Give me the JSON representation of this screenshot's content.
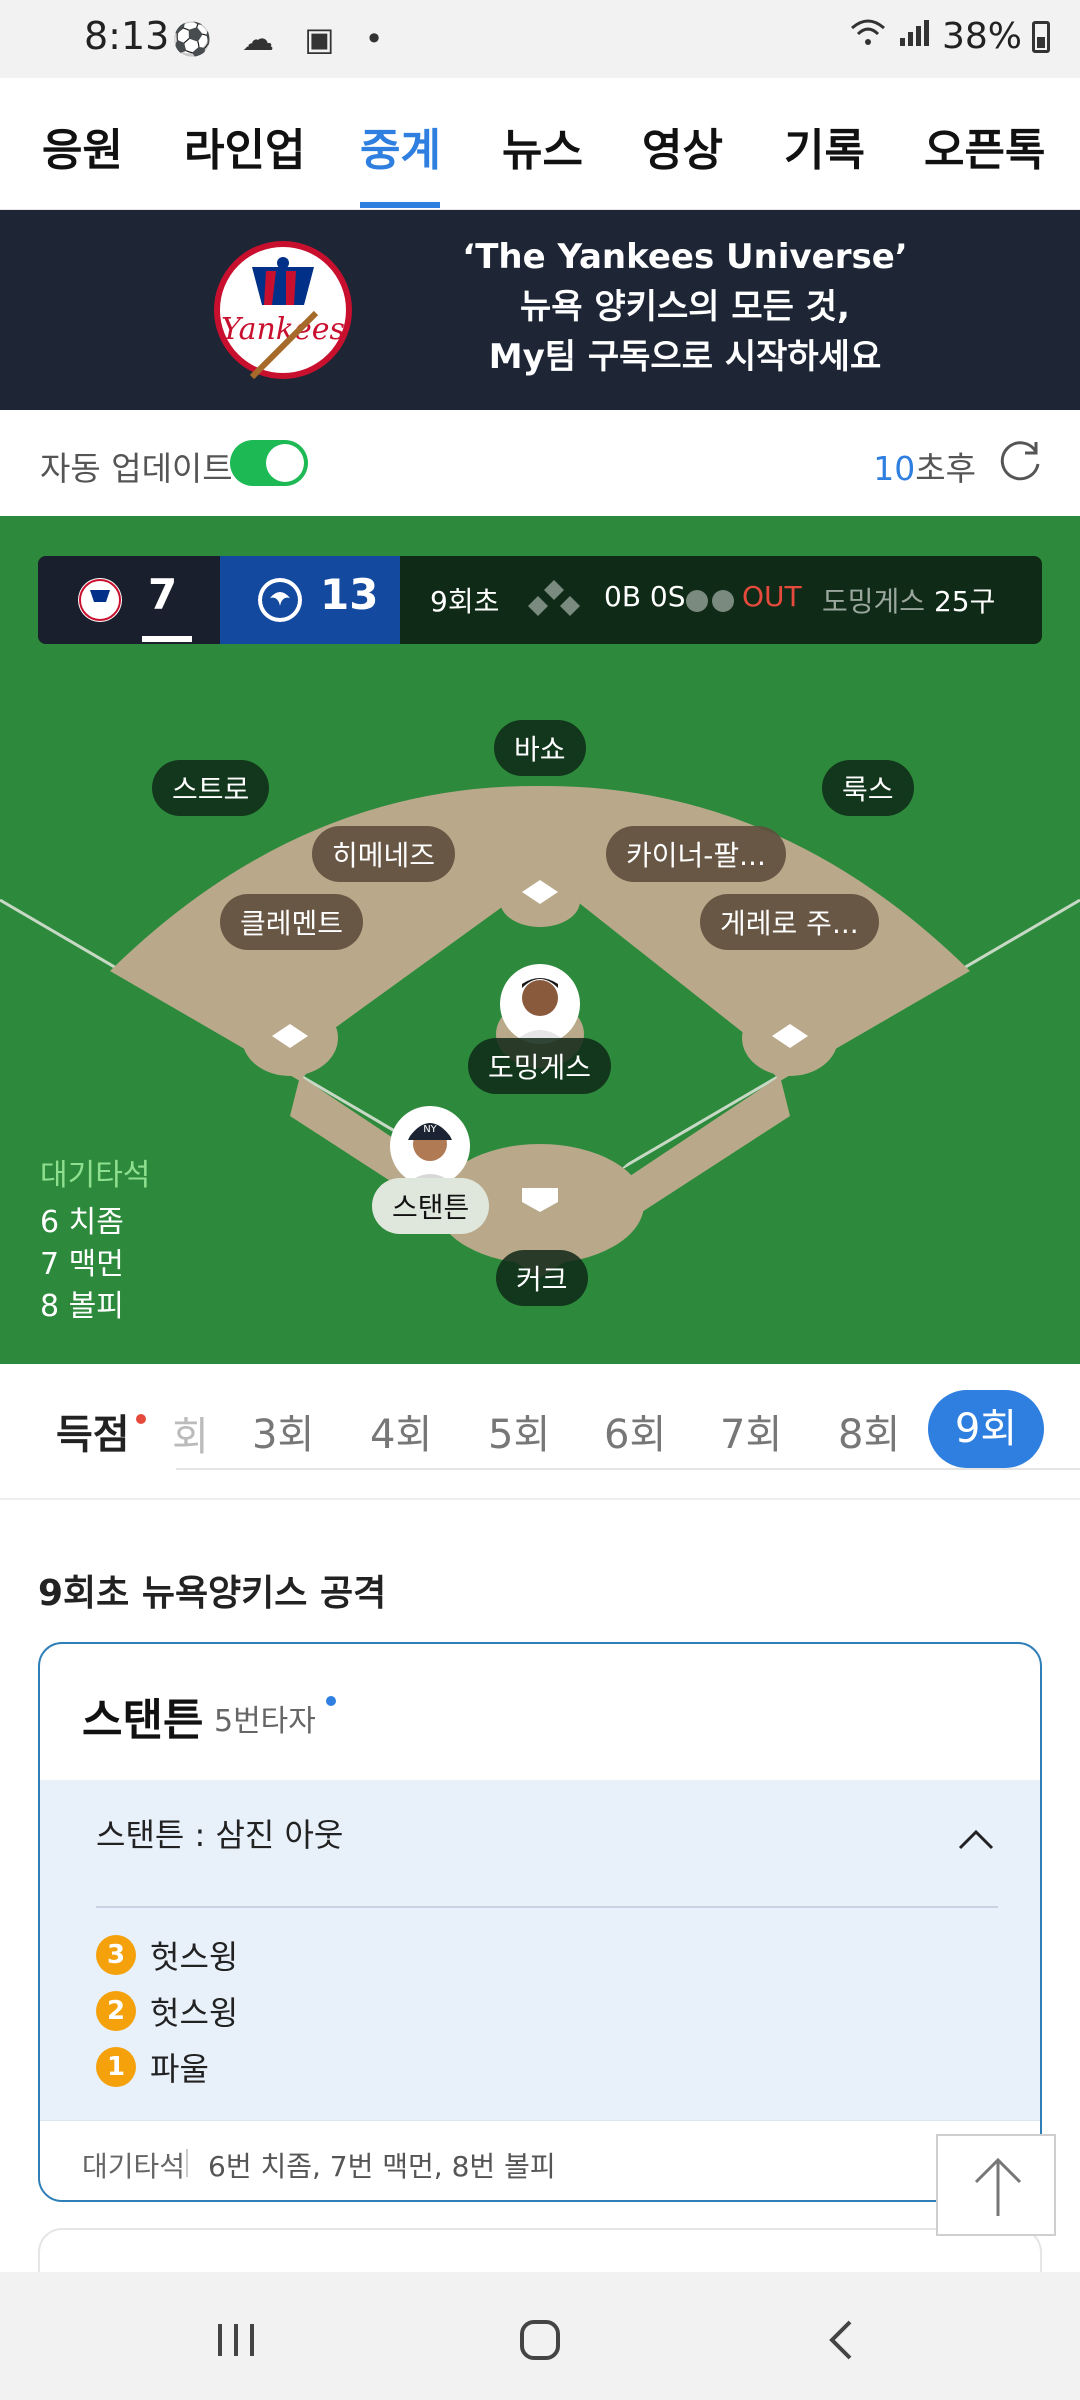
{
  "status_bar": {
    "time": "8:13",
    "battery": "38%"
  },
  "tabs": [
    {
      "label": "응원"
    },
    {
      "label": "라인업"
    },
    {
      "label": "중계",
      "active": true
    },
    {
      "label": "뉴스"
    },
    {
      "label": "영상"
    },
    {
      "label": "기록"
    },
    {
      "label": "오픈톡"
    }
  ],
  "banner": {
    "line1": "‘The Yankees Universe’",
    "line2": "뉴욕 양키스의 모든 것,",
    "line3": "My팀 구독으로 시작하세요"
  },
  "auto_update": {
    "label": "자동 업데이트",
    "enabled": true,
    "countdown_num": "10",
    "countdown_suffix": "초후"
  },
  "scoreboard": {
    "away_score": "7",
    "home_score": "13",
    "inning": "9회초",
    "count": "0B 0S",
    "out_label": "OUT",
    "pitcher": "도밍게스",
    "pitch_count": "25구"
  },
  "field": {
    "positions": {
      "center": "바쇼",
      "left": "스트로",
      "right": "룩스",
      "shortstop": "히메네즈",
      "second": "카이너-팔...",
      "third": "클레멘트",
      "first": "게레로 주...",
      "pitcher": "도밍게스",
      "batter": "스탠튼",
      "catcher": "커크"
    },
    "waiting_title": "대기타석",
    "waiting": [
      "6 치좀",
      "7 맥먼",
      "8 볼피"
    ]
  },
  "innings": {
    "score_label": "득점",
    "fragment": "회",
    "items": [
      "3회",
      "4회",
      "5회",
      "6회",
      "7회",
      "8회"
    ],
    "active": "9회"
  },
  "play": {
    "section_title": "9회초 뉴욕양키스 공격",
    "batter": "스탠튼",
    "batting_order": "5번타자",
    "result": "스탠튼 : 삼진 아웃",
    "pitches": [
      {
        "num": "3",
        "desc": "헛스윙"
      },
      {
        "num": "2",
        "desc": "헛스윙"
      },
      {
        "num": "1",
        "desc": "파울"
      }
    ],
    "footer_label": "대기타석",
    "footer_value": "6번 치좀, 7번 맥먼, 8번 볼피"
  },
  "colors": {
    "accent": "#2e7fe0",
    "field": "#2d8a3c",
    "infield_dirt": "#b9a98a",
    "banner": "#1e2636",
    "out": "#e64a3c",
    "pitch_badge": "#f4a10b"
  }
}
